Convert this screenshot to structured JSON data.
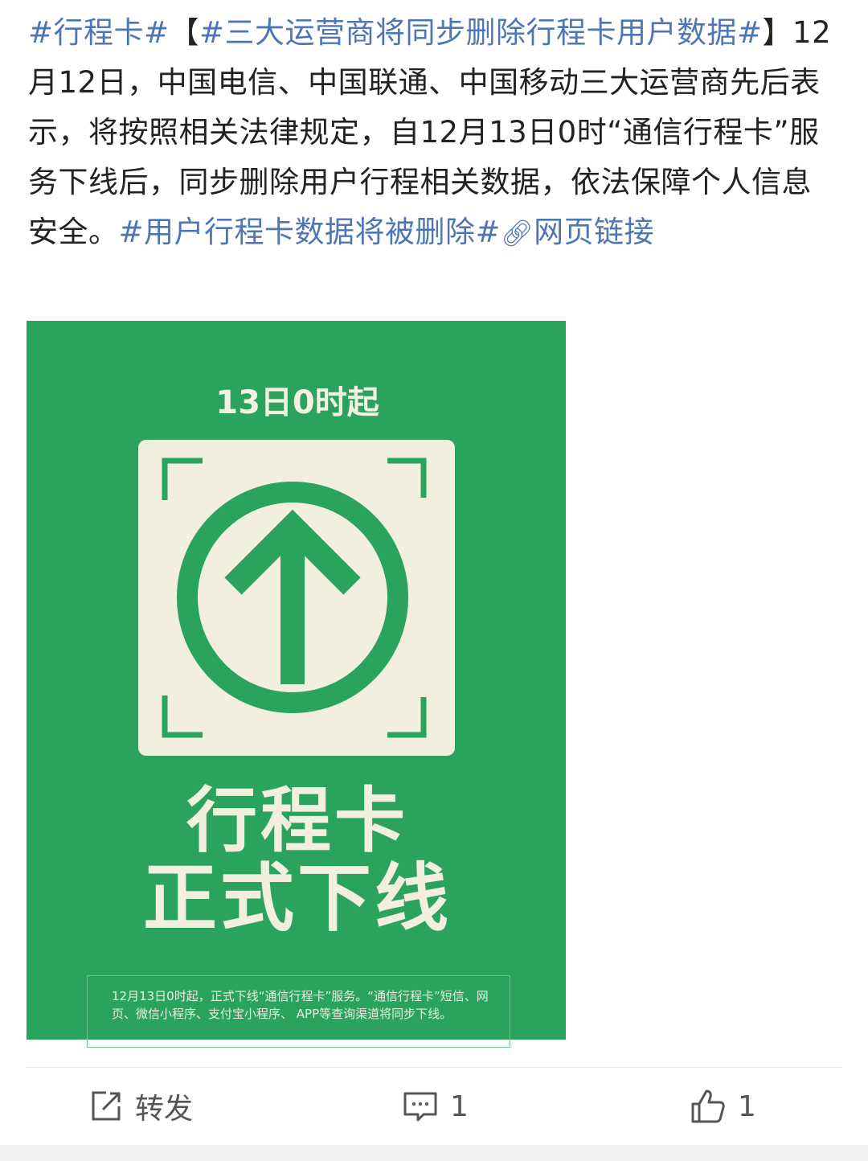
{
  "post": {
    "tag_card": "#行程卡#",
    "bracket_open": "【",
    "tag_headline": "#三大运营商将同步删除行程卡用户数据#",
    "bracket_close": "】",
    "body": "12月12日，中国电信、中国联通、中国移动三大运营商先后表示，将按照相关法律规定，自12月13日0时“通信行程卡”服务下线后，同步删除用户行程相关数据，依法保障个人信息安全。",
    "tag_deleted": "#用户行程卡数据将被删除#",
    "link_icon": "link-icon",
    "link_text": "网页链接"
  },
  "poster": {
    "time_label": "13日0时起",
    "title_line1": "行程卡",
    "title_line2": "正式下线",
    "notice": "12月13日0时起，正式下线“通信行程卡”服务。“通信行程卡”短信、网页、微信小程序、支付宝小程序、 APP等查询渠道将同步下线。",
    "colors": {
      "background": "#2aa35f",
      "card": "#f3efdf",
      "icon": "#2aa35f"
    },
    "icon": "up-arrow-circle-icon"
  },
  "actions": {
    "repost_icon": "share-icon",
    "repost_label": "转发",
    "comment_icon": "comment-icon",
    "comment_count": "1",
    "like_icon": "thumbs-up-icon",
    "like_count": "1"
  },
  "colors": {
    "link": "#4e76b4",
    "text": "#222222"
  }
}
